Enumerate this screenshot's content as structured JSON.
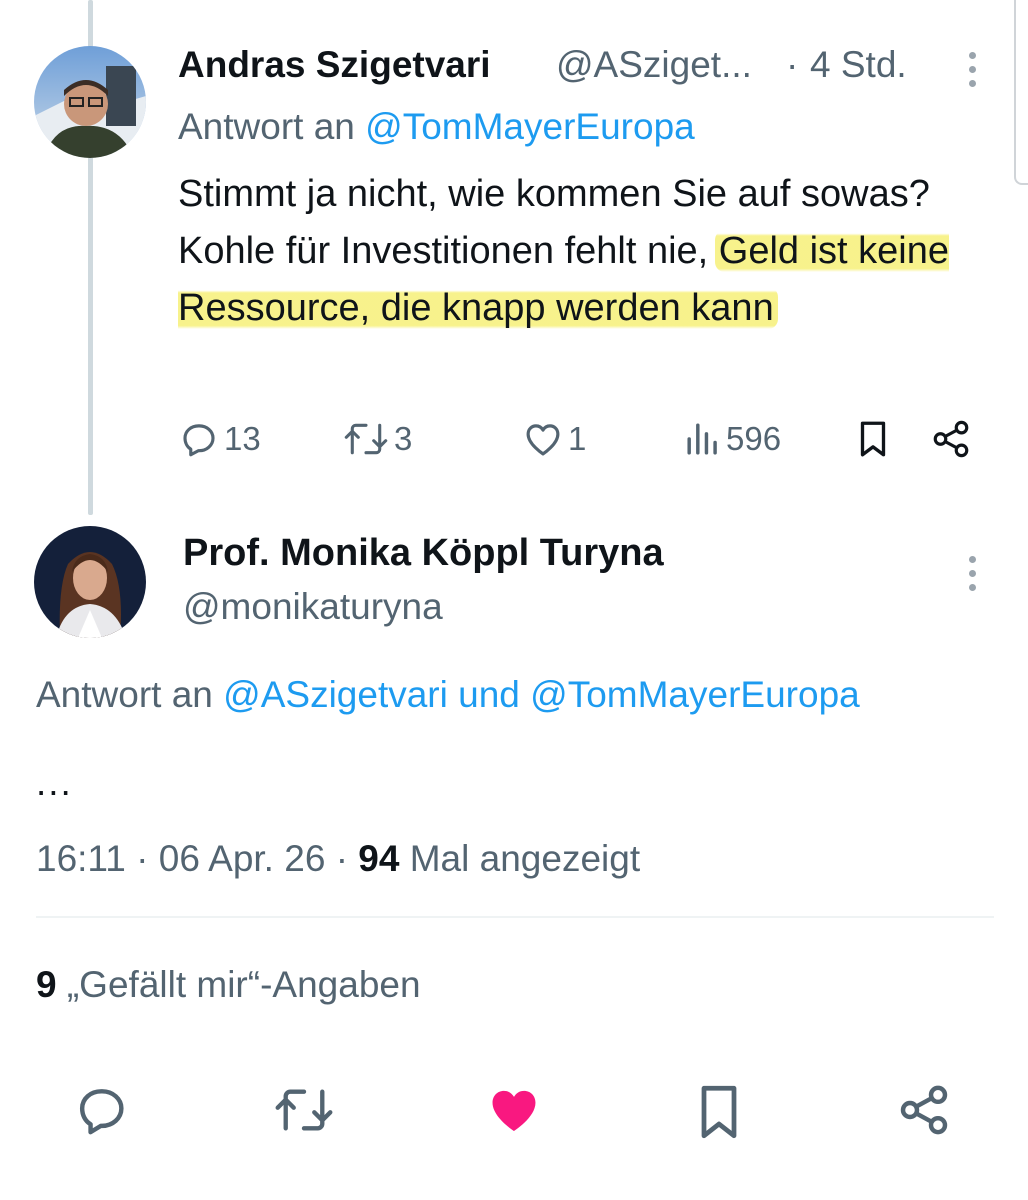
{
  "reply_tweet": {
    "author_name": "Andras Szigetvari",
    "author_handle": "@ASziget...",
    "separator": "·",
    "time": "4 Std.",
    "reply_prefix": "Antwort an ",
    "reply_mention": "@TomMayerEuropa",
    "text_plain": "Stimmt ja nicht, wie kommen Sie auf sowas? Kohle für Investitionen fehlt nie,",
    "text_highlighted": "Geld ist keine Ressource, die knapp werden kann",
    "stats": {
      "replies": "13",
      "retweets": "3",
      "likes": "1",
      "views": "596"
    }
  },
  "main_tweet": {
    "author_name": "Prof. Monika Köppl Turyna",
    "author_handle": "@monikaturyna",
    "reply_prefix": "Antwort an ",
    "reply_mention_1": "@ASzigetvari",
    "reply_conjunction": " und ",
    "reply_mention_2": "@TomMayerEuropa",
    "body": "...",
    "timestamp_time": "16:11",
    "timestamp_date": "06 Apr. 26",
    "separator": "·",
    "view_count": "94",
    "view_suffix": "Mal angezeigt",
    "like_count": "9",
    "like_suffix": "„Gefällt mir“-Angaben"
  },
  "colors": {
    "link": "#1d9bf0",
    "secondary": "#536471",
    "like_active": "#f91880",
    "highlight": "#f6f078"
  },
  "icons": [
    "reply-icon",
    "retweet-icon",
    "like-icon",
    "views-icon",
    "bookmark-icon",
    "share-icon",
    "more-icon"
  ]
}
